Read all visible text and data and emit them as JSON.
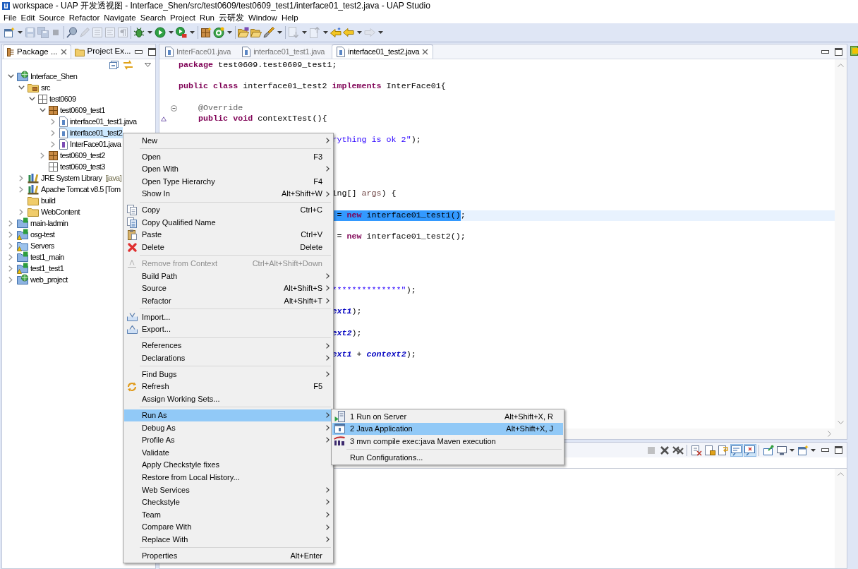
{
  "window": {
    "title": "workspace - UAP 开发透视图 - Interface_Shen/src/test0609/test0609_test1/interface01_test2.java - UAP Studio"
  },
  "menu_bar": [
    "File",
    "Edit",
    "Source",
    "Refactor",
    "Navigate",
    "Search",
    "Project",
    "Run",
    "云研发",
    "Window",
    "Help"
  ],
  "toolbar": [
    {
      "disabled": false
    },
    {
      "disabled": true
    },
    {
      "disabled": true
    },
    {
      "disabled": true
    },
    {
      "disabled": false
    },
    {
      "disabled": true
    },
    {
      "disabled": true
    },
    {
      "disabled": true
    },
    {
      "disabled": true
    },
    {
      "disabled": false
    },
    {
      "disabled": false
    },
    {
      "disabled": false
    },
    {
      "disabled": false
    },
    {
      "disabled": false
    },
    {
      "disabled": false
    },
    {
      "disabled": false
    },
    {
      "disabled": false
    },
    {
      "disabled": true
    },
    {
      "disabled": true
    },
    {
      "disabled": false
    },
    {
      "disabled": false
    },
    {
      "disabled": true
    }
  ],
  "package_explorer": {
    "tabs": [
      {
        "label": "Package ...",
        "selected": true
      },
      {
        "label": "Project Ex...",
        "selected": false
      }
    ],
    "tree": [
      {
        "label": "Interface_Shen",
        "kind": "web_project",
        "has_children": true,
        "expanded": true,
        "selected": false,
        "warning": false,
        "children": [
          {
            "label": "src",
            "kind": "source_folder",
            "has_children": true,
            "expanded": true,
            "selected": false,
            "children": [
              {
                "label": "test0609",
                "kind": "empty_package",
                "has_children": true,
                "expanded": true,
                "selected": false,
                "children": [
                  {
                    "label": "test0609_test1",
                    "kind": "package",
                    "has_children": true,
                    "expanded": true,
                    "selected": false,
                    "children": [
                      {
                        "label": "interface01_test1.java",
                        "kind": "class_file",
                        "has_children": true,
                        "expanded": false,
                        "selected": false
                      },
                      {
                        "label": "interface01_test2",
                        "kind": "class_file",
                        "has_children": true,
                        "expanded": false,
                        "selected": true
                      },
                      {
                        "label": "InterFace01.java",
                        "kind": "interface_file",
                        "has_children": true,
                        "expanded": false,
                        "selected": false
                      }
                    ]
                  },
                  {
                    "label": "test0609_test2",
                    "kind": "package",
                    "has_children": true,
                    "expanded": false,
                    "selected": false
                  },
                  {
                    "label": "test0609_test3",
                    "kind": "empty_package",
                    "has_children": false,
                    "selected": false
                  }
                ]
              }
            ]
          },
          {
            "label": "JRE System Library",
            "decoration": "[java]",
            "kind": "library",
            "has_children": true,
            "expanded": false,
            "selected": false
          },
          {
            "label": "Apache Tomcat v8.5 [Tom",
            "kind": "library",
            "has_children": true,
            "expanded": false,
            "selected": false
          },
          {
            "label": "build",
            "kind": "folder",
            "has_children": false,
            "selected": false
          },
          {
            "label": "WebContent",
            "kind": "folder",
            "has_children": true,
            "expanded": false,
            "selected": false
          }
        ]
      },
      {
        "label": "main-ladmin",
        "kind": "maven_project",
        "has_children": true,
        "expanded": false,
        "selected": false,
        "warning": false
      },
      {
        "label": "osg-test",
        "kind": "maven_project",
        "has_children": true,
        "expanded": false,
        "selected": false,
        "warning": true
      },
      {
        "label": "Servers",
        "kind": "folder_project",
        "has_children": true,
        "expanded": false,
        "selected": false,
        "warning": true
      },
      {
        "label": "test1_main",
        "kind": "maven_project",
        "has_children": true,
        "expanded": false,
        "selected": false,
        "warning": false
      },
      {
        "label": "test1_test1",
        "kind": "maven_project",
        "has_children": true,
        "expanded": false,
        "selected": false,
        "warning": true
      },
      {
        "label": "web_project",
        "kind": "web_project",
        "has_children": true,
        "expanded": false,
        "selected": false,
        "warning": false
      }
    ]
  },
  "editor": {
    "tabs": [
      {
        "label": "InterFace01.java",
        "selected": false
      },
      {
        "label": "interface01_test1.java",
        "selected": false
      },
      {
        "label": "interface01_test2.java",
        "selected": true
      }
    ],
    "lines": [
      {
        "kind": "code",
        "current": false,
        "tokens": [
          {
            "text": "package",
            "kind": "keyword"
          },
          {
            "text": " test0609.test0609_test1;",
            "kind": "plain"
          }
        ]
      },
      {
        "kind": "blank",
        "current": false
      },
      {
        "kind": "code",
        "current": false,
        "tokens": [
          {
            "text": "public class",
            "kind": "keyword"
          },
          {
            "text": " interface01_test2 ",
            "kind": "plain"
          },
          {
            "text": "implements",
            "kind": "keyword"
          },
          {
            "text": " InterFace01{",
            "kind": "plain"
          }
        ]
      },
      {
        "kind": "blank",
        "current": false
      },
      {
        "kind": "code",
        "current": false,
        "foldable": true,
        "tokens": [
          {
            "text": "    @Override",
            "kind": "annotation"
          }
        ]
      },
      {
        "kind": "code",
        "current": false,
        "overrides": true,
        "tokens": [
          {
            "text": "    public void",
            "kind": "keyword"
          },
          {
            "text": " contextTest(){",
            "kind": "plain"
          }
        ]
      },
      {
        "kind": "blank",
        "current": false
      },
      {
        "kind": "clipped",
        "current": false,
        "tokens": [
          {
            "text": "rything is ok 2\"",
            "kind": "string"
          },
          {
            "text": ");",
            "kind": "plain"
          }
        ]
      },
      {
        "kind": "blank",
        "current": false
      },
      {
        "kind": "blank",
        "current": false
      },
      {
        "kind": "blank",
        "current": false
      },
      {
        "kind": "blank",
        "current": false
      },
      {
        "kind": "clipped",
        "current": false,
        "tokens": [
          {
            "text": "ing[] ",
            "kind": "plain"
          },
          {
            "text": "args",
            "kind": "parameter"
          },
          {
            "text": ") {",
            "kind": "plain"
          }
        ]
      },
      {
        "kind": "blank",
        "current": false
      },
      {
        "kind": "clipped",
        "current": true,
        "tokens": [
          {
            "text": " = ",
            "kind": "plain",
            "selected": true
          },
          {
            "text": "new",
            "kind": "keyword",
            "selected": true
          },
          {
            "text": " interface01_test1()",
            "kind": "plain",
            "selected": true
          },
          {
            "text": ";",
            "kind": "plain",
            "selected": false
          }
        ]
      },
      {
        "kind": "blank",
        "current": false
      },
      {
        "kind": "clipped",
        "current": false,
        "tokens": [
          {
            "text": " = ",
            "kind": "plain"
          },
          {
            "text": "new",
            "kind": "keyword"
          },
          {
            "text": " interface01_test2();",
            "kind": "plain"
          }
        ]
      },
      {
        "kind": "blank",
        "current": false
      },
      {
        "kind": "blank",
        "current": false
      },
      {
        "kind": "blank",
        "current": false
      },
      {
        "kind": "blank",
        "current": false
      },
      {
        "kind": "clipped",
        "current": false,
        "tokens": [
          {
            "text": "**************\"",
            "kind": "string"
          },
          {
            "text": ");",
            "kind": "plain"
          }
        ]
      },
      {
        "kind": "blank",
        "current": false
      },
      {
        "kind": "clipped",
        "current": false,
        "tokens": [
          {
            "text": "ext1",
            "kind": "field"
          },
          {
            "text": ");",
            "kind": "plain"
          }
        ]
      },
      {
        "kind": "blank",
        "current": false
      },
      {
        "kind": "clipped",
        "current": false,
        "tokens": [
          {
            "text": "ext2",
            "kind": "field"
          },
          {
            "text": ");",
            "kind": "plain"
          }
        ]
      },
      {
        "kind": "blank",
        "current": false
      },
      {
        "kind": "clipped",
        "current": false,
        "tokens": [
          {
            "text": "ext1",
            "kind": "field"
          },
          {
            "text": " + ",
            "kind": "plain"
          },
          {
            "text": "context2",
            "kind": "field"
          },
          {
            "text": ");",
            "kind": "plain"
          }
        ]
      }
    ]
  },
  "console_toolbar": [
    {
      "disabled": true,
      "pressed": false
    },
    {
      "disabled": false,
      "pressed": false
    },
    {
      "disabled": false,
      "pressed": false
    },
    {
      "disabled": false,
      "pressed": false
    },
    {
      "disabled": false,
      "pressed": false
    },
    {
      "disabled": false,
      "pressed": false
    },
    {
      "disabled": false,
      "pressed": true
    },
    {
      "disabled": false,
      "pressed": true
    },
    {
      "disabled": false,
      "pressed": false
    },
    {
      "disabled": false,
      "pressed": false
    },
    {
      "disabled": false,
      "pressed": false
    }
  ],
  "context_menu": {
    "groups": [
      [
        {
          "label": "New",
          "submenu": true,
          "disabled": false,
          "highlighted": false
        }
      ],
      [
        {
          "label": "Open",
          "shortcut": "F3",
          "submenu": false,
          "disabled": false,
          "highlighted": false
        },
        {
          "label": "Open With",
          "submenu": true,
          "disabled": false,
          "highlighted": false
        },
        {
          "label": "Open Type Hierarchy",
          "shortcut": "F4",
          "submenu": false,
          "disabled": false,
          "highlighted": false
        },
        {
          "label": "Show In",
          "shortcut": "Alt+Shift+W",
          "submenu": true,
          "disabled": false,
          "highlighted": false
        }
      ],
      [
        {
          "label": "Copy",
          "shortcut": "Ctrl+C",
          "submenu": false,
          "disabled": false,
          "highlighted": false
        },
        {
          "label": "Copy Qualified Name",
          "submenu": false,
          "disabled": false,
          "highlighted": false
        },
        {
          "label": "Paste",
          "shortcut": "Ctrl+V",
          "submenu": false,
          "disabled": false,
          "highlighted": false
        },
        {
          "label": "Delete",
          "shortcut": "Delete",
          "submenu": false,
          "disabled": false,
          "highlighted": false
        }
      ],
      [
        {
          "label": "Remove from Context",
          "shortcut": "Ctrl+Alt+Shift+Down",
          "submenu": false,
          "disabled": true,
          "highlighted": false
        },
        {
          "label": "Build Path",
          "submenu": true,
          "disabled": false,
          "highlighted": false
        },
        {
          "label": "Source",
          "shortcut": "Alt+Shift+S",
          "submenu": true,
          "disabled": false,
          "highlighted": false
        },
        {
          "label": "Refactor",
          "shortcut": "Alt+Shift+T",
          "submenu": true,
          "disabled": false,
          "highlighted": false
        }
      ],
      [
        {
          "label": "Import...",
          "submenu": false,
          "disabled": false,
          "highlighted": false
        },
        {
          "label": "Export...",
          "submenu": false,
          "disabled": false,
          "highlighted": false
        }
      ],
      [
        {
          "label": "References",
          "submenu": true,
          "disabled": false,
          "highlighted": false
        },
        {
          "label": "Declarations",
          "submenu": true,
          "disabled": false,
          "highlighted": false
        }
      ],
      [
        {
          "label": "Find Bugs",
          "submenu": true,
          "disabled": false,
          "highlighted": false
        },
        {
          "label": "Refresh",
          "shortcut": "F5",
          "submenu": false,
          "disabled": false,
          "highlighted": false
        },
        {
          "label": "Assign Working Sets...",
          "submenu": false,
          "disabled": false,
          "highlighted": false
        }
      ],
      [
        {
          "label": "Run As",
          "submenu": true,
          "disabled": false,
          "highlighted": true
        },
        {
          "label": "Debug As",
          "submenu": true,
          "disabled": false,
          "highlighted": false
        },
        {
          "label": "Profile As",
          "submenu": true,
          "disabled": false,
          "highlighted": false
        },
        {
          "label": "Validate",
          "submenu": false,
          "disabled": false,
          "highlighted": false
        },
        {
          "label": "Apply Checkstyle fixes",
          "submenu": false,
          "disabled": false,
          "highlighted": false
        },
        {
          "label": "Restore from Local History...",
          "submenu": false,
          "disabled": false,
          "highlighted": false
        },
        {
          "label": "Web Services",
          "submenu": true,
          "disabled": false,
          "highlighted": false
        },
        {
          "label": "Checkstyle",
          "submenu": true,
          "disabled": false,
          "highlighted": false
        },
        {
          "label": "Team",
          "submenu": true,
          "disabled": false,
          "highlighted": false
        },
        {
          "label": "Compare With",
          "submenu": true,
          "disabled": false,
          "highlighted": false
        },
        {
          "label": "Replace With",
          "submenu": true,
          "disabled": false,
          "highlighted": false
        }
      ],
      [
        {
          "label": "Properties",
          "shortcut": "Alt+Enter",
          "submenu": false,
          "disabled": false,
          "highlighted": false
        }
      ]
    ]
  },
  "submenu": {
    "groups": [
      [
        {
          "label": "1 Run on Server",
          "shortcut": "Alt+Shift+X, R",
          "submenu": false,
          "disabled": false,
          "highlighted": false
        },
        {
          "label": "2 Java Application",
          "shortcut": "Alt+Shift+X, J",
          "submenu": false,
          "disabled": false,
          "highlighted": true
        },
        {
          "label": "3 mvn compile exec:java Maven execution",
          "submenu": false,
          "disabled": false,
          "highlighted": false
        }
      ],
      [
        {
          "label": "Run Configurations...",
          "submenu": false,
          "disabled": false,
          "highlighted": false
        }
      ]
    ]
  }
}
